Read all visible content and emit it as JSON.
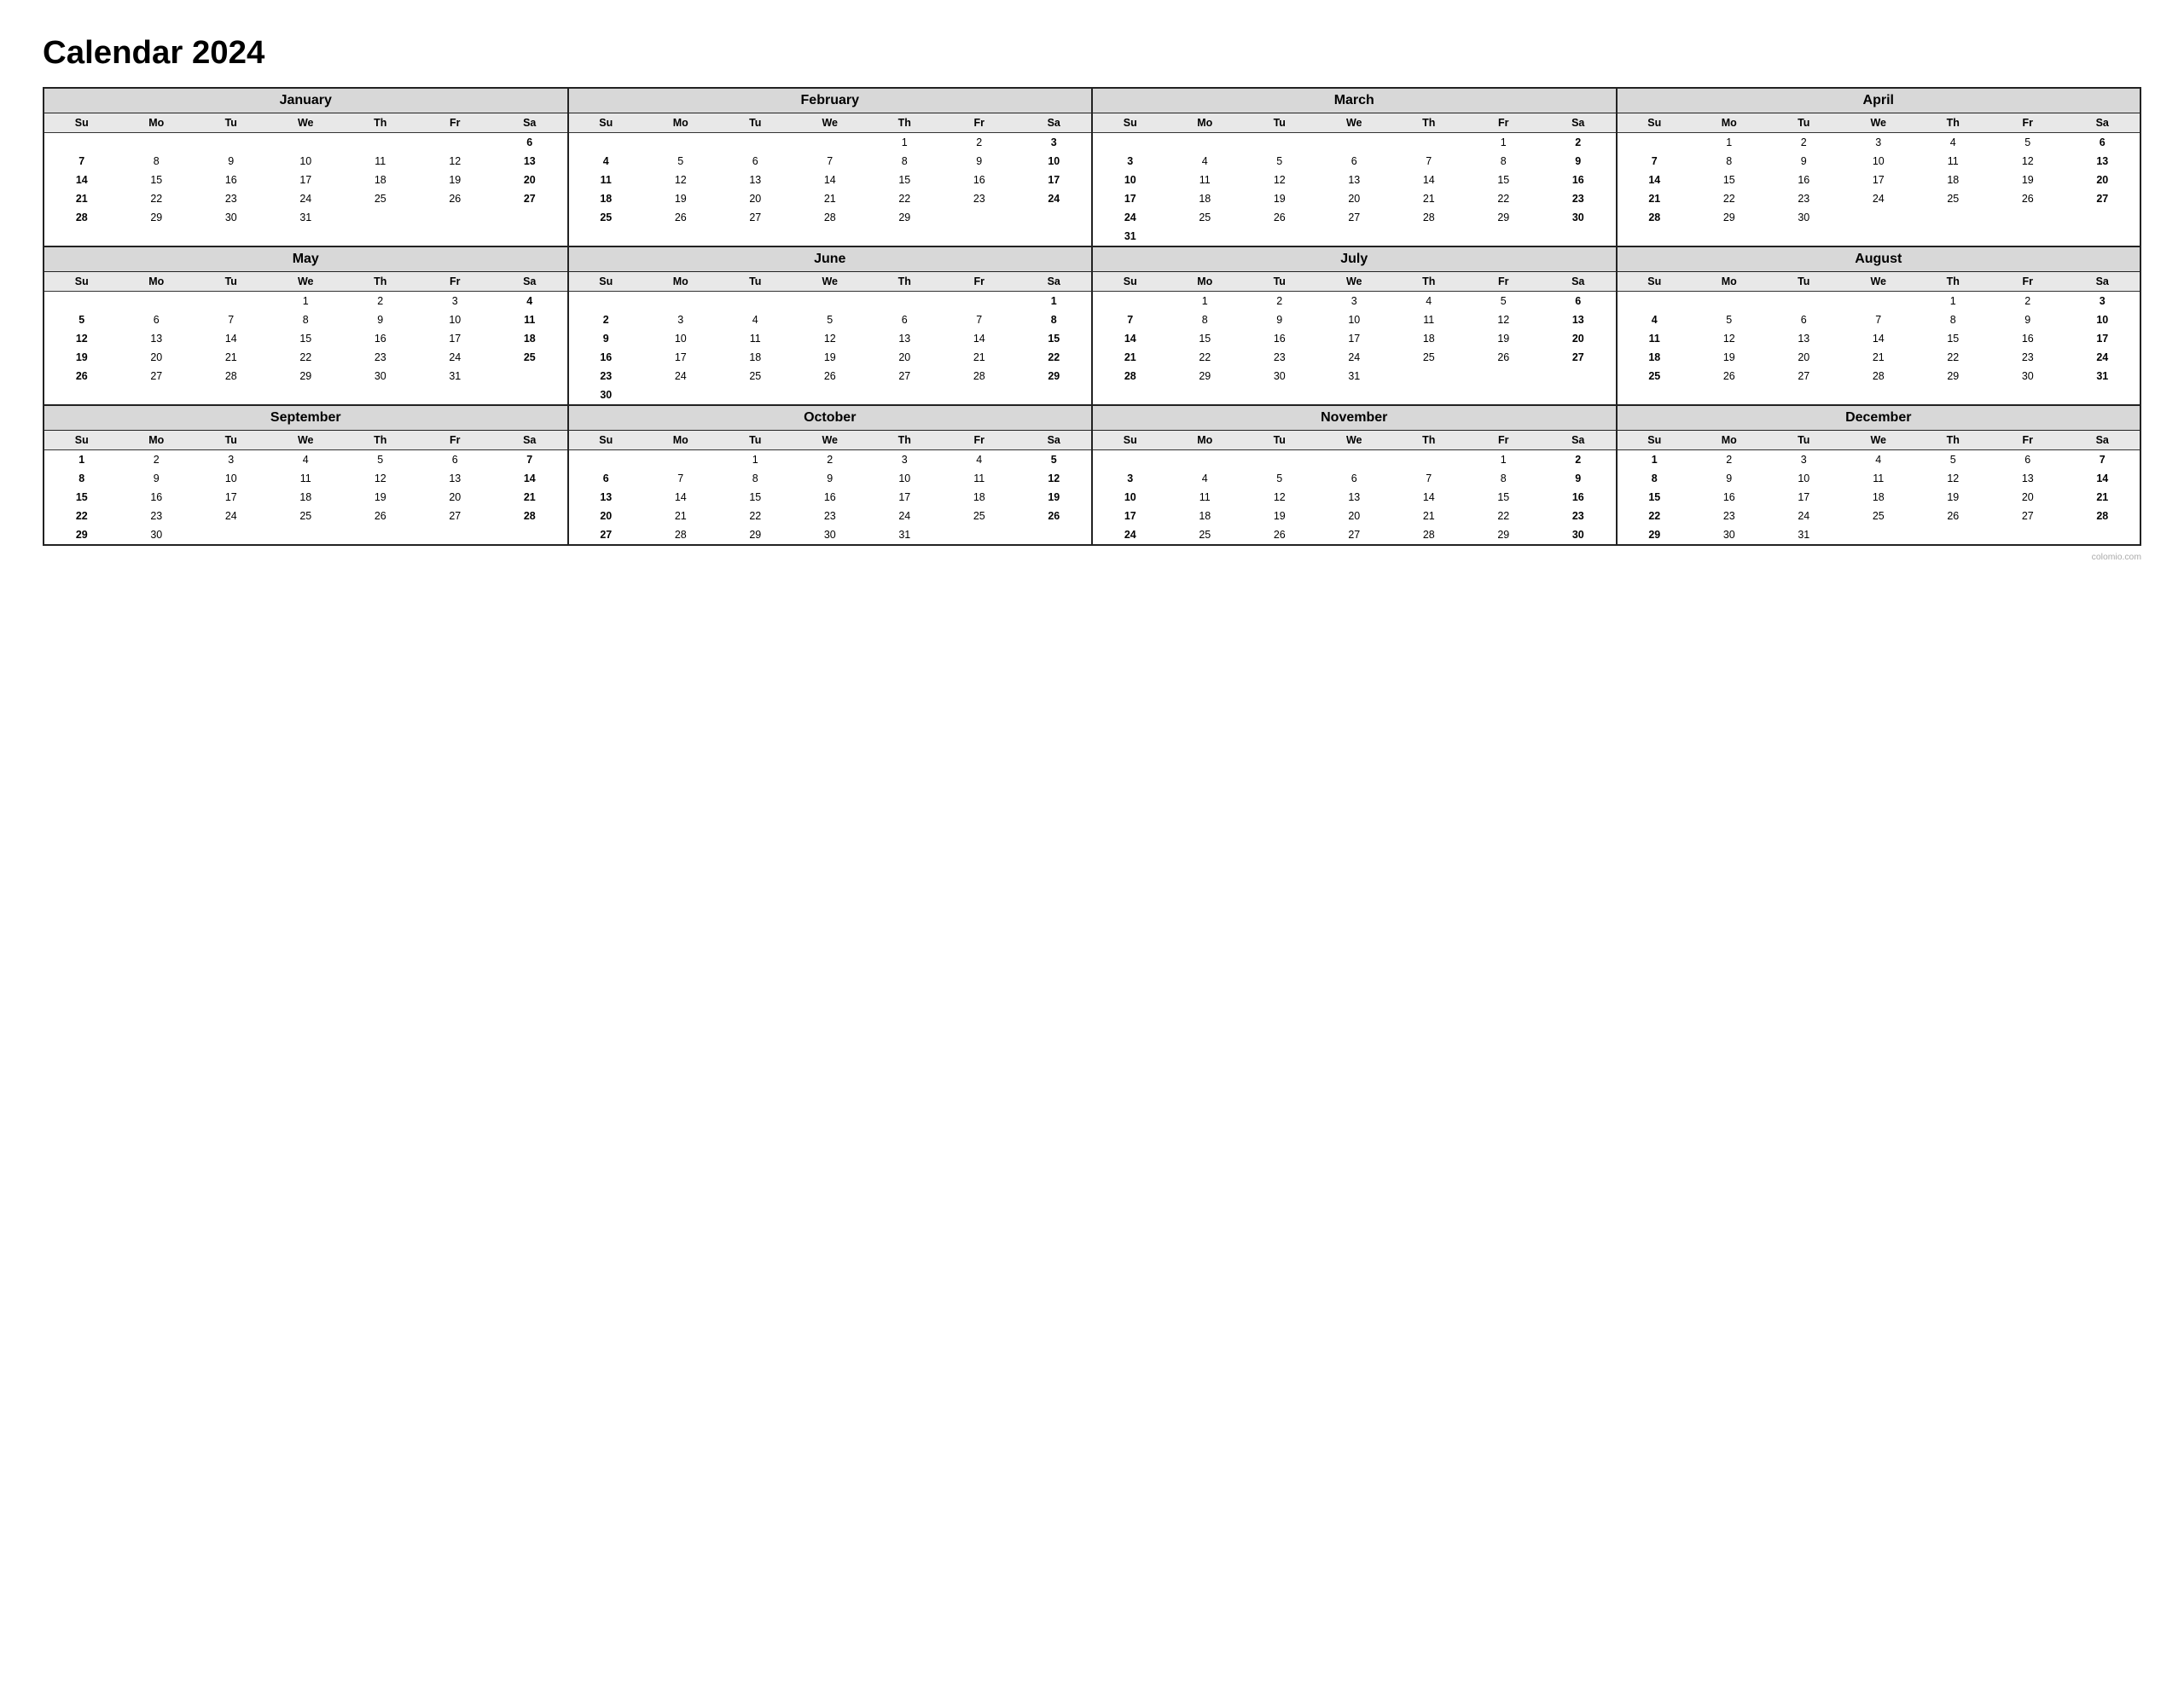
{
  "title": "Calendar 2024",
  "watermark": "colomio.com",
  "months": [
    {
      "name": "January",
      "days": [
        [
          "",
          "",
          "",
          "",
          "",
          "",
          "6"
        ],
        [
          "7",
          "8",
          "9",
          "10",
          "11",
          "12",
          "13"
        ],
        [
          "14",
          "15",
          "16",
          "17",
          "18",
          "19",
          "20"
        ],
        [
          "21",
          "22",
          "23",
          "24",
          "25",
          "26",
          "27"
        ],
        [
          "28",
          "29",
          "30",
          "31",
          "",
          "",
          ""
        ]
      ],
      "start_offset": 1
    },
    {
      "name": "February",
      "days": [
        [
          "",
          "",
          "",
          "",
          "1",
          "2",
          "3"
        ],
        [
          "4",
          "5",
          "6",
          "7",
          "8",
          "9",
          "10"
        ],
        [
          "11",
          "12",
          "13",
          "14",
          "15",
          "16",
          "17"
        ],
        [
          "18",
          "19",
          "20",
          "21",
          "22",
          "23",
          "24"
        ],
        [
          "25",
          "26",
          "27",
          "28",
          "29",
          "",
          ""
        ]
      ]
    },
    {
      "name": "March",
      "days": [
        [
          "",
          "",
          "",
          "",
          "",
          "1",
          "2"
        ],
        [
          "3",
          "4",
          "5",
          "6",
          "7",
          "8",
          "9"
        ],
        [
          "10",
          "11",
          "12",
          "13",
          "14",
          "15",
          "16"
        ],
        [
          "17",
          "18",
          "19",
          "20",
          "21",
          "22",
          "23"
        ],
        [
          "24",
          "25",
          "26",
          "27",
          "28",
          "29",
          "30"
        ],
        [
          "31",
          "",
          "",
          "",
          "",
          "",
          ""
        ]
      ]
    },
    {
      "name": "April",
      "days": [
        [
          "",
          "1",
          "2",
          "3",
          "4",
          "5",
          "6"
        ],
        [
          "7",
          "8",
          "9",
          "10",
          "11",
          "12",
          "13"
        ],
        [
          "14",
          "15",
          "16",
          "17",
          "18",
          "19",
          "20"
        ],
        [
          "21",
          "22",
          "23",
          "24",
          "25",
          "26",
          "27"
        ],
        [
          "28",
          "29",
          "30",
          "",
          "",
          "",
          ""
        ]
      ]
    },
    {
      "name": "May",
      "days": [
        [
          "",
          "",
          "",
          "1",
          "2",
          "3",
          "4"
        ],
        [
          "5",
          "6",
          "7",
          "8",
          "9",
          "10",
          "11"
        ],
        [
          "12",
          "13",
          "14",
          "15",
          "16",
          "17",
          "18"
        ],
        [
          "19",
          "20",
          "21",
          "22",
          "23",
          "24",
          "25"
        ],
        [
          "26",
          "27",
          "28",
          "29",
          "30",
          "31",
          ""
        ]
      ]
    },
    {
      "name": "June",
      "days": [
        [
          "",
          "",
          "",
          "",
          "",
          "",
          "1"
        ],
        [
          "2",
          "3",
          "4",
          "5",
          "6",
          "7",
          "8"
        ],
        [
          "9",
          "10",
          "11",
          "12",
          "13",
          "14",
          "15"
        ],
        [
          "16",
          "17",
          "18",
          "19",
          "20",
          "21",
          "22"
        ],
        [
          "23",
          "24",
          "25",
          "26",
          "27",
          "28",
          "29"
        ],
        [
          "30",
          "",
          "",
          "",
          "",
          "",
          ""
        ]
      ]
    },
    {
      "name": "July",
      "days": [
        [
          "",
          "1",
          "2",
          "3",
          "4",
          "5",
          "6"
        ],
        [
          "7",
          "8",
          "9",
          "10",
          "11",
          "12",
          "13"
        ],
        [
          "14",
          "15",
          "16",
          "17",
          "18",
          "19",
          "20"
        ],
        [
          "21",
          "22",
          "23",
          "24",
          "25",
          "26",
          "27"
        ],
        [
          "28",
          "29",
          "30",
          "31",
          "",
          "",
          ""
        ]
      ]
    },
    {
      "name": "August",
      "days": [
        [
          "",
          "",
          "",
          "",
          "1",
          "2",
          "3"
        ],
        [
          "4",
          "5",
          "6",
          "7",
          "8",
          "9",
          "10"
        ],
        [
          "11",
          "12",
          "13",
          "14",
          "15",
          "16",
          "17"
        ],
        [
          "18",
          "19",
          "20",
          "21",
          "22",
          "23",
          "24"
        ],
        [
          "25",
          "26",
          "27",
          "28",
          "29",
          "30",
          "31"
        ]
      ]
    },
    {
      "name": "September",
      "days": [
        [
          "1",
          "2",
          "3",
          "4",
          "5",
          "6",
          "7"
        ],
        [
          "8",
          "9",
          "10",
          "11",
          "12",
          "13",
          "14"
        ],
        [
          "15",
          "16",
          "17",
          "18",
          "19",
          "20",
          "21"
        ],
        [
          "22",
          "23",
          "24",
          "25",
          "26",
          "27",
          "28"
        ],
        [
          "29",
          "30",
          "",
          "",
          "",
          "",
          ""
        ]
      ]
    },
    {
      "name": "October",
      "days": [
        [
          "",
          "",
          "1",
          "2",
          "3",
          "4",
          "5"
        ],
        [
          "6",
          "7",
          "8",
          "9",
          "10",
          "11",
          "12"
        ],
        [
          "13",
          "14",
          "15",
          "16",
          "17",
          "18",
          "19"
        ],
        [
          "20",
          "21",
          "22",
          "23",
          "24",
          "25",
          "26"
        ],
        [
          "27",
          "28",
          "29",
          "30",
          "31",
          "",
          ""
        ]
      ]
    },
    {
      "name": "November",
      "days": [
        [
          "",
          "",
          "",
          "",
          "",
          "1",
          "2"
        ],
        [
          "3",
          "4",
          "5",
          "6",
          "7",
          "8",
          "9"
        ],
        [
          "10",
          "11",
          "12",
          "13",
          "14",
          "15",
          "16"
        ],
        [
          "17",
          "18",
          "19",
          "20",
          "21",
          "22",
          "23"
        ],
        [
          "24",
          "25",
          "26",
          "27",
          "28",
          "29",
          "30"
        ]
      ]
    },
    {
      "name": "December",
      "days": [
        [
          "1",
          "2",
          "3",
          "4",
          "5",
          "6",
          "7"
        ],
        [
          "8",
          "9",
          "10",
          "11",
          "12",
          "13",
          "14"
        ],
        [
          "15",
          "16",
          "17",
          "18",
          "19",
          "20",
          "21"
        ],
        [
          "22",
          "23",
          "24",
          "25",
          "26",
          "27",
          "28"
        ],
        [
          "29",
          "30",
          "31",
          "",
          "",
          "",
          ""
        ]
      ]
    }
  ],
  "day_headers": [
    "Su",
    "Mo",
    "Tu",
    "We",
    "Th",
    "Fr",
    "Sa"
  ]
}
